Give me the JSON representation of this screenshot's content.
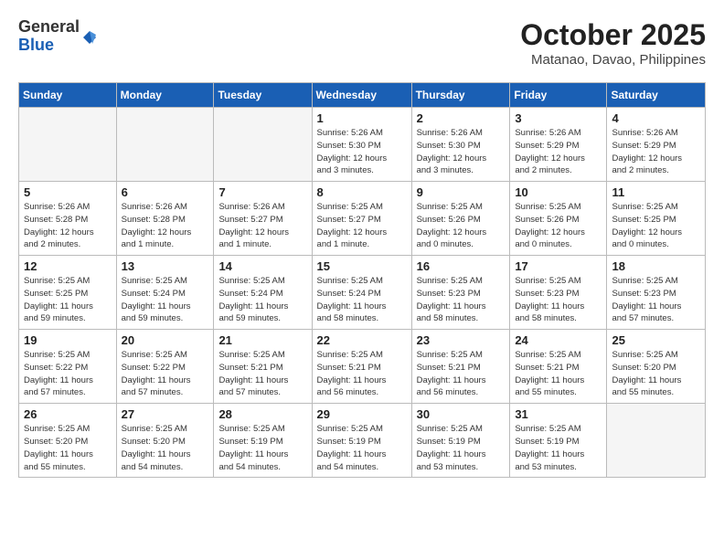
{
  "header": {
    "logo_general": "General",
    "logo_blue": "Blue",
    "month": "October 2025",
    "location": "Matanao, Davao, Philippines"
  },
  "weekdays": [
    "Sunday",
    "Monday",
    "Tuesday",
    "Wednesday",
    "Thursday",
    "Friday",
    "Saturday"
  ],
  "weeks": [
    [
      {
        "day": "",
        "info": ""
      },
      {
        "day": "",
        "info": ""
      },
      {
        "day": "",
        "info": ""
      },
      {
        "day": "1",
        "info": "Sunrise: 5:26 AM\nSunset: 5:30 PM\nDaylight: 12 hours\nand 3 minutes."
      },
      {
        "day": "2",
        "info": "Sunrise: 5:26 AM\nSunset: 5:30 PM\nDaylight: 12 hours\nand 3 minutes."
      },
      {
        "day": "3",
        "info": "Sunrise: 5:26 AM\nSunset: 5:29 PM\nDaylight: 12 hours\nand 2 minutes."
      },
      {
        "day": "4",
        "info": "Sunrise: 5:26 AM\nSunset: 5:29 PM\nDaylight: 12 hours\nand 2 minutes."
      }
    ],
    [
      {
        "day": "5",
        "info": "Sunrise: 5:26 AM\nSunset: 5:28 PM\nDaylight: 12 hours\nand 2 minutes."
      },
      {
        "day": "6",
        "info": "Sunrise: 5:26 AM\nSunset: 5:28 PM\nDaylight: 12 hours\nand 1 minute."
      },
      {
        "day": "7",
        "info": "Sunrise: 5:26 AM\nSunset: 5:27 PM\nDaylight: 12 hours\nand 1 minute."
      },
      {
        "day": "8",
        "info": "Sunrise: 5:25 AM\nSunset: 5:27 PM\nDaylight: 12 hours\nand 1 minute."
      },
      {
        "day": "9",
        "info": "Sunrise: 5:25 AM\nSunset: 5:26 PM\nDaylight: 12 hours\nand 0 minutes."
      },
      {
        "day": "10",
        "info": "Sunrise: 5:25 AM\nSunset: 5:26 PM\nDaylight: 12 hours\nand 0 minutes."
      },
      {
        "day": "11",
        "info": "Sunrise: 5:25 AM\nSunset: 5:25 PM\nDaylight: 12 hours\nand 0 minutes."
      }
    ],
    [
      {
        "day": "12",
        "info": "Sunrise: 5:25 AM\nSunset: 5:25 PM\nDaylight: 11 hours\nand 59 minutes."
      },
      {
        "day": "13",
        "info": "Sunrise: 5:25 AM\nSunset: 5:24 PM\nDaylight: 11 hours\nand 59 minutes."
      },
      {
        "day": "14",
        "info": "Sunrise: 5:25 AM\nSunset: 5:24 PM\nDaylight: 11 hours\nand 59 minutes."
      },
      {
        "day": "15",
        "info": "Sunrise: 5:25 AM\nSunset: 5:24 PM\nDaylight: 11 hours\nand 58 minutes."
      },
      {
        "day": "16",
        "info": "Sunrise: 5:25 AM\nSunset: 5:23 PM\nDaylight: 11 hours\nand 58 minutes."
      },
      {
        "day": "17",
        "info": "Sunrise: 5:25 AM\nSunset: 5:23 PM\nDaylight: 11 hours\nand 58 minutes."
      },
      {
        "day": "18",
        "info": "Sunrise: 5:25 AM\nSunset: 5:23 PM\nDaylight: 11 hours\nand 57 minutes."
      }
    ],
    [
      {
        "day": "19",
        "info": "Sunrise: 5:25 AM\nSunset: 5:22 PM\nDaylight: 11 hours\nand 57 minutes."
      },
      {
        "day": "20",
        "info": "Sunrise: 5:25 AM\nSunset: 5:22 PM\nDaylight: 11 hours\nand 57 minutes."
      },
      {
        "day": "21",
        "info": "Sunrise: 5:25 AM\nSunset: 5:21 PM\nDaylight: 11 hours\nand 57 minutes."
      },
      {
        "day": "22",
        "info": "Sunrise: 5:25 AM\nSunset: 5:21 PM\nDaylight: 11 hours\nand 56 minutes."
      },
      {
        "day": "23",
        "info": "Sunrise: 5:25 AM\nSunset: 5:21 PM\nDaylight: 11 hours\nand 56 minutes."
      },
      {
        "day": "24",
        "info": "Sunrise: 5:25 AM\nSunset: 5:21 PM\nDaylight: 11 hours\nand 55 minutes."
      },
      {
        "day": "25",
        "info": "Sunrise: 5:25 AM\nSunset: 5:20 PM\nDaylight: 11 hours\nand 55 minutes."
      }
    ],
    [
      {
        "day": "26",
        "info": "Sunrise: 5:25 AM\nSunset: 5:20 PM\nDaylight: 11 hours\nand 55 minutes."
      },
      {
        "day": "27",
        "info": "Sunrise: 5:25 AM\nSunset: 5:20 PM\nDaylight: 11 hours\nand 54 minutes."
      },
      {
        "day": "28",
        "info": "Sunrise: 5:25 AM\nSunset: 5:19 PM\nDaylight: 11 hours\nand 54 minutes."
      },
      {
        "day": "29",
        "info": "Sunrise: 5:25 AM\nSunset: 5:19 PM\nDaylight: 11 hours\nand 54 minutes."
      },
      {
        "day": "30",
        "info": "Sunrise: 5:25 AM\nSunset: 5:19 PM\nDaylight: 11 hours\nand 53 minutes."
      },
      {
        "day": "31",
        "info": "Sunrise: 5:25 AM\nSunset: 5:19 PM\nDaylight: 11 hours\nand 53 minutes."
      },
      {
        "day": "",
        "info": ""
      }
    ]
  ]
}
